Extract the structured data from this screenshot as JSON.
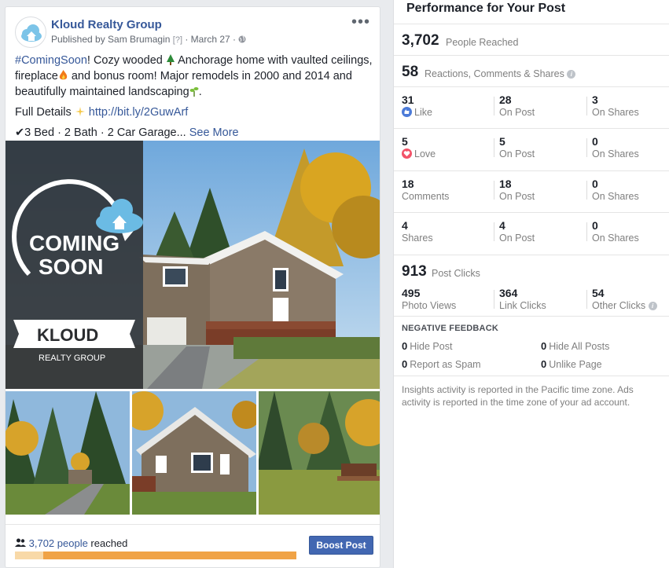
{
  "post": {
    "page_name": "Kloud Realty Group",
    "published_by": "Published by Sam Brumagin",
    "help_marker": "[?]",
    "date": "March 27",
    "hashtag": "#ComingSoon",
    "text_part1": "! Cozy wooded",
    "text_part2": " Anchorage home with vaulted ceilings,",
    "text_part3": "fireplace",
    "text_part4": " and bonus room! Major remodels in 2000 and 2014 and",
    "text_part5": "beautifully maintained landscaping",
    "text_part6": ".",
    "details_label": "Full Details",
    "details_link": "http://bit.ly/2GuwArf",
    "features": "3 Bed · 2 Bath · 2 Car Garage...",
    "see_more": "See More",
    "hero_banner_line1": "COMING",
    "hero_banner_line2": "SOON",
    "hero_brand": "KLOUD",
    "hero_brand_sub": "REALTY GROUP",
    "reached_count": "3,702 people",
    "reached_suffix": " reached",
    "reach_progress": 0.1,
    "boost_label": "Boost Post"
  },
  "panel": {
    "title": "Performance for Your Post",
    "people_reached": {
      "value": "3,702",
      "label": "People Reached"
    },
    "engagement": {
      "value": "58",
      "label": "Reactions, Comments & Shares"
    },
    "reactions": [
      {
        "value": "31",
        "label": "Like",
        "icon": "like-icon",
        "on_post": "28",
        "on_post_label": "On Post",
        "on_shares": "3",
        "on_shares_label": "On Shares"
      },
      {
        "value": "5",
        "label": "Love",
        "icon": "love-icon",
        "on_post": "5",
        "on_post_label": "On Post",
        "on_shares": "0",
        "on_shares_label": "On Shares"
      },
      {
        "value": "18",
        "label": "Comments",
        "on_post": "18",
        "on_post_label": "On Post",
        "on_shares": "0",
        "on_shares_label": "On Shares"
      },
      {
        "value": "4",
        "label": "Shares",
        "on_post": "4",
        "on_post_label": "On Post",
        "on_shares": "0",
        "on_shares_label": "On Shares"
      }
    ],
    "post_clicks": {
      "value": "913",
      "label": "Post Clicks"
    },
    "clicks": [
      {
        "value": "495",
        "label": "Photo Views"
      },
      {
        "value": "364",
        "label": "Link Clicks"
      },
      {
        "value": "54",
        "label": "Other Clicks"
      }
    ],
    "negative_header": "NEGATIVE FEEDBACK",
    "negative": [
      {
        "value": "0",
        "label": "Hide Post"
      },
      {
        "value": "0",
        "label": "Hide All Posts"
      },
      {
        "value": "0",
        "label": "Report as Spam"
      },
      {
        "value": "0",
        "label": "Unlike Page"
      }
    ],
    "note": "Insights activity is reported in the Pacific time zone. Ads activity is reported in the time zone of your ad account."
  },
  "colors": {
    "link": "#365899",
    "boost": "#4267b2",
    "progress": "#f0a346",
    "like": "#4c7bd8",
    "love": "#f25268"
  }
}
